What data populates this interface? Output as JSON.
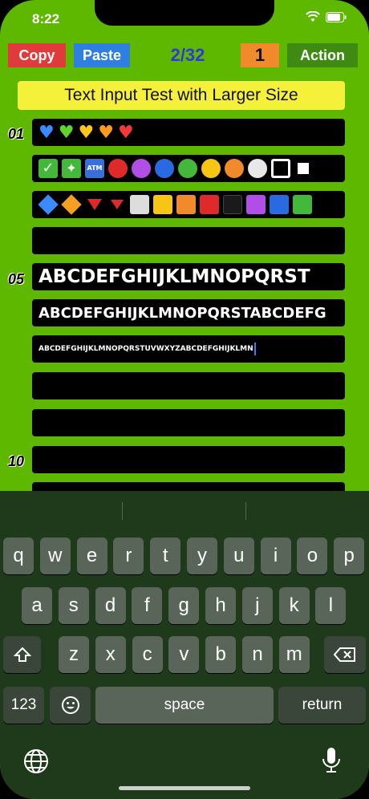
{
  "status": {
    "time": "8:22"
  },
  "toolbar": {
    "copy": "Copy",
    "paste": "Paste",
    "counter": "2/32",
    "page": "1",
    "action": "Action"
  },
  "title": "Text Input Test with Larger Size",
  "rows": {
    "n01": "01",
    "n05": "05",
    "n10": "10",
    "text5": "ABCDEFGHIJKLMNOPQRST",
    "text6": "ABCDEFGHIJKLMNOPQRSTABCDEFG",
    "text7": "ABCDEFGHIJKLMNOPQRSTUVWXYZABCDEFGHIJKLMN"
  },
  "emoji": {
    "hearts": [
      "💙",
      "💚",
      "💛",
      "🧡",
      "❤️"
    ],
    "atm": "ATM"
  },
  "keyboard": {
    "row1": [
      "q",
      "w",
      "e",
      "r",
      "t",
      "y",
      "u",
      "i",
      "o",
      "p"
    ],
    "row2": [
      "a",
      "s",
      "d",
      "f",
      "g",
      "h",
      "j",
      "k",
      "l"
    ],
    "row3": [
      "z",
      "x",
      "c",
      "v",
      "b",
      "n",
      "m"
    ],
    "num": "123",
    "space": "space",
    "return": "return"
  },
  "colors": {
    "bg": "#5fb800",
    "copy": "#e03a3a",
    "paste": "#2f7fe0",
    "page": "#f08a2a",
    "action": "#3e8a12",
    "counter": "#2d3ad8"
  }
}
